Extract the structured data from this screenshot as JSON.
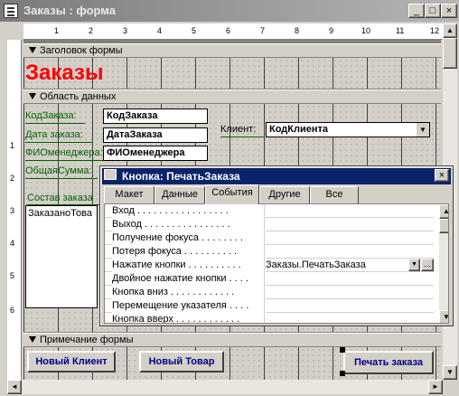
{
  "window": {
    "title": "Заказы : форма",
    "min": "_",
    "max": "□",
    "close": "×"
  },
  "ruler": {
    "top": [
      "1",
      "2",
      "3",
      "4",
      "5",
      "6",
      "7",
      "8",
      "9",
      "10",
      "11",
      "12"
    ],
    "left": [
      "1",
      "2",
      "3",
      "4",
      "5",
      "6"
    ]
  },
  "sections": {
    "header": "Заголовок формы",
    "detail": "Область данных",
    "footer": "Примечание формы"
  },
  "form_header": {
    "title": "Заказы",
    "title_color": "#ff0000"
  },
  "fields": [
    {
      "label": "КодЗаказа:",
      "value": "КодЗаказа"
    },
    {
      "label": "Дата заказа:",
      "value": "ДатаЗаказа"
    },
    {
      "label": "ФИОменеджера:",
      "value": "ФИОменеджера"
    },
    {
      "label": "ОбщаяСумма:",
      "value": ""
    }
  ],
  "client": {
    "label": "Клиент:",
    "value": "КодКлиента"
  },
  "subform": {
    "label": "Состав заказа",
    "content": "ЗаказаноТова"
  },
  "footer_buttons": {
    "new_client": "Новый Клиент",
    "new_product": "Новый Товар",
    "print_order": "Печать заказа"
  },
  "property_sheet": {
    "title": "Кнопка: ПечатьЗаказа",
    "tabs": [
      "Макет",
      "Данные",
      "События",
      "Другие",
      "Все"
    ],
    "active_tab": "События",
    "rows": [
      {
        "name": "Вход . . . . . . . . . . . . . . . . .",
        "value": ""
      },
      {
        "name": "Выход . . . . . . . . . . . . . . . .",
        "value": ""
      },
      {
        "name": "Получение фокуса . . . . . . . .",
        "value": ""
      },
      {
        "name": "Потеря фокуса . . . . . . . . . .",
        "value": ""
      },
      {
        "name": "Нажатие кнопки . . . . . . . . . .",
        "value": "Заказы.ПечатьЗаказа"
      },
      {
        "name": "Двойное нажатие кнопки . . . .",
        "value": ""
      },
      {
        "name": "Кнопка вниз . . . . . . . . . . . .",
        "value": ""
      },
      {
        "name": "Перемещение указателя . . . .",
        "value": ""
      },
      {
        "name": "Кнопка вверх . . . . . . . . . . . .",
        "value": ""
      }
    ],
    "builder": "...",
    "selection_color": "#0a246a"
  }
}
